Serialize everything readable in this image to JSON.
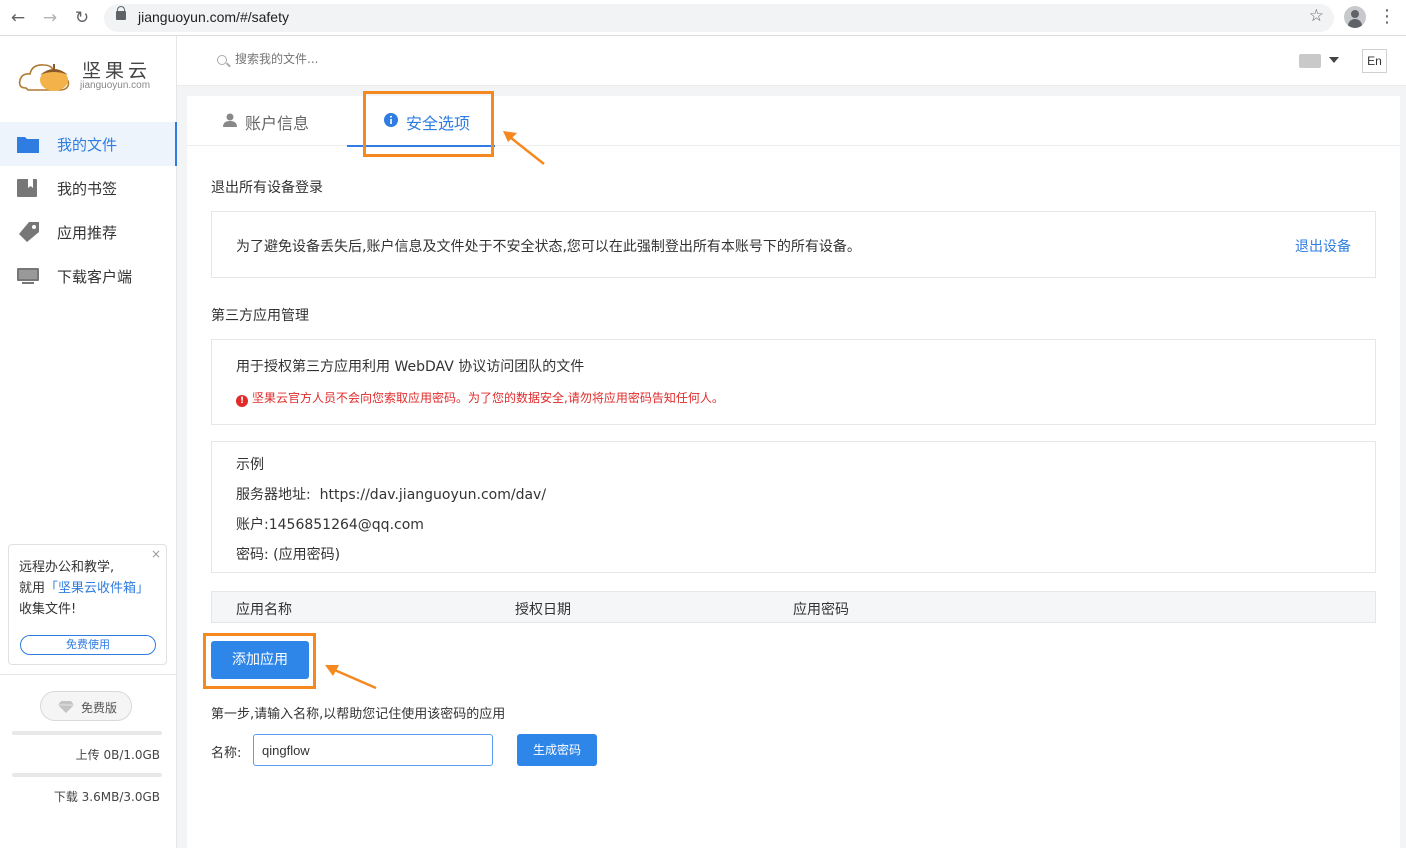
{
  "browser": {
    "url": "jianguoyun.com/#/safety"
  },
  "sidebar": {
    "logo": {
      "brand": "坚果云",
      "sub": "jianguoyun.com"
    },
    "items": [
      {
        "label": "我的文件",
        "icon": "folder-icon"
      },
      {
        "label": "我的书签",
        "icon": "bookmark-icon"
      },
      {
        "label": "应用推荐",
        "icon": "tag-icon"
      },
      {
        "label": "下载客户端",
        "icon": "monitor-icon"
      }
    ],
    "promo": {
      "line1": "远程办公和教学,",
      "line2_prefix": "就用",
      "line2_link": "「坚果云收件箱」",
      "line3": "收集文件!",
      "button": "免费使用",
      "close": "×"
    },
    "edition": "免费版",
    "upload": "上传 0B/1.0GB",
    "download": "下载 3.6MB/3.0GB"
  },
  "header": {
    "search_placeholder": "搜索我的文件...",
    "lang": "En"
  },
  "tabs": [
    {
      "label": "账户信息",
      "icon": "user-icon"
    },
    {
      "label": "安全选项",
      "icon": "info-icon"
    }
  ],
  "logout_section": {
    "title": "退出所有设备登录",
    "desc": "为了避免设备丢失后,账户信息及文件处于不安全状态,您可以在此强制登出所有本账号下的所有设备。",
    "link": "退出设备"
  },
  "third_party": {
    "title": "第三方应用管理",
    "desc": "用于授权第三方应用利用 WebDAV 协议访问团队的文件",
    "warning": "坚果云官方人员不会向您索取应用密码。为了您的数据安全,请勿将应用密码告知任何人。",
    "warning_icon": "!"
  },
  "example": {
    "title": "示例",
    "server_label": "服务器地址:",
    "server_value": "https://dav.jianguoyun.com/dav/",
    "account_label": "账户:",
    "account_value": "1456851264@qq.com",
    "password_label": "密码:",
    "password_value": "(应用密码)"
  },
  "table": {
    "headers": [
      "应用名称",
      "授权日期",
      "应用密码"
    ]
  },
  "add_app": {
    "button": "添加应用",
    "step": "第一步,请输入名称,以帮助您记住使用该密码的应用",
    "name_label": "名称:",
    "name_value": "qingflow",
    "generate": "生成密码"
  },
  "colors": {
    "accent": "#2f7de1",
    "warning": "#e12b2b",
    "highlight": "#f5881f"
  }
}
